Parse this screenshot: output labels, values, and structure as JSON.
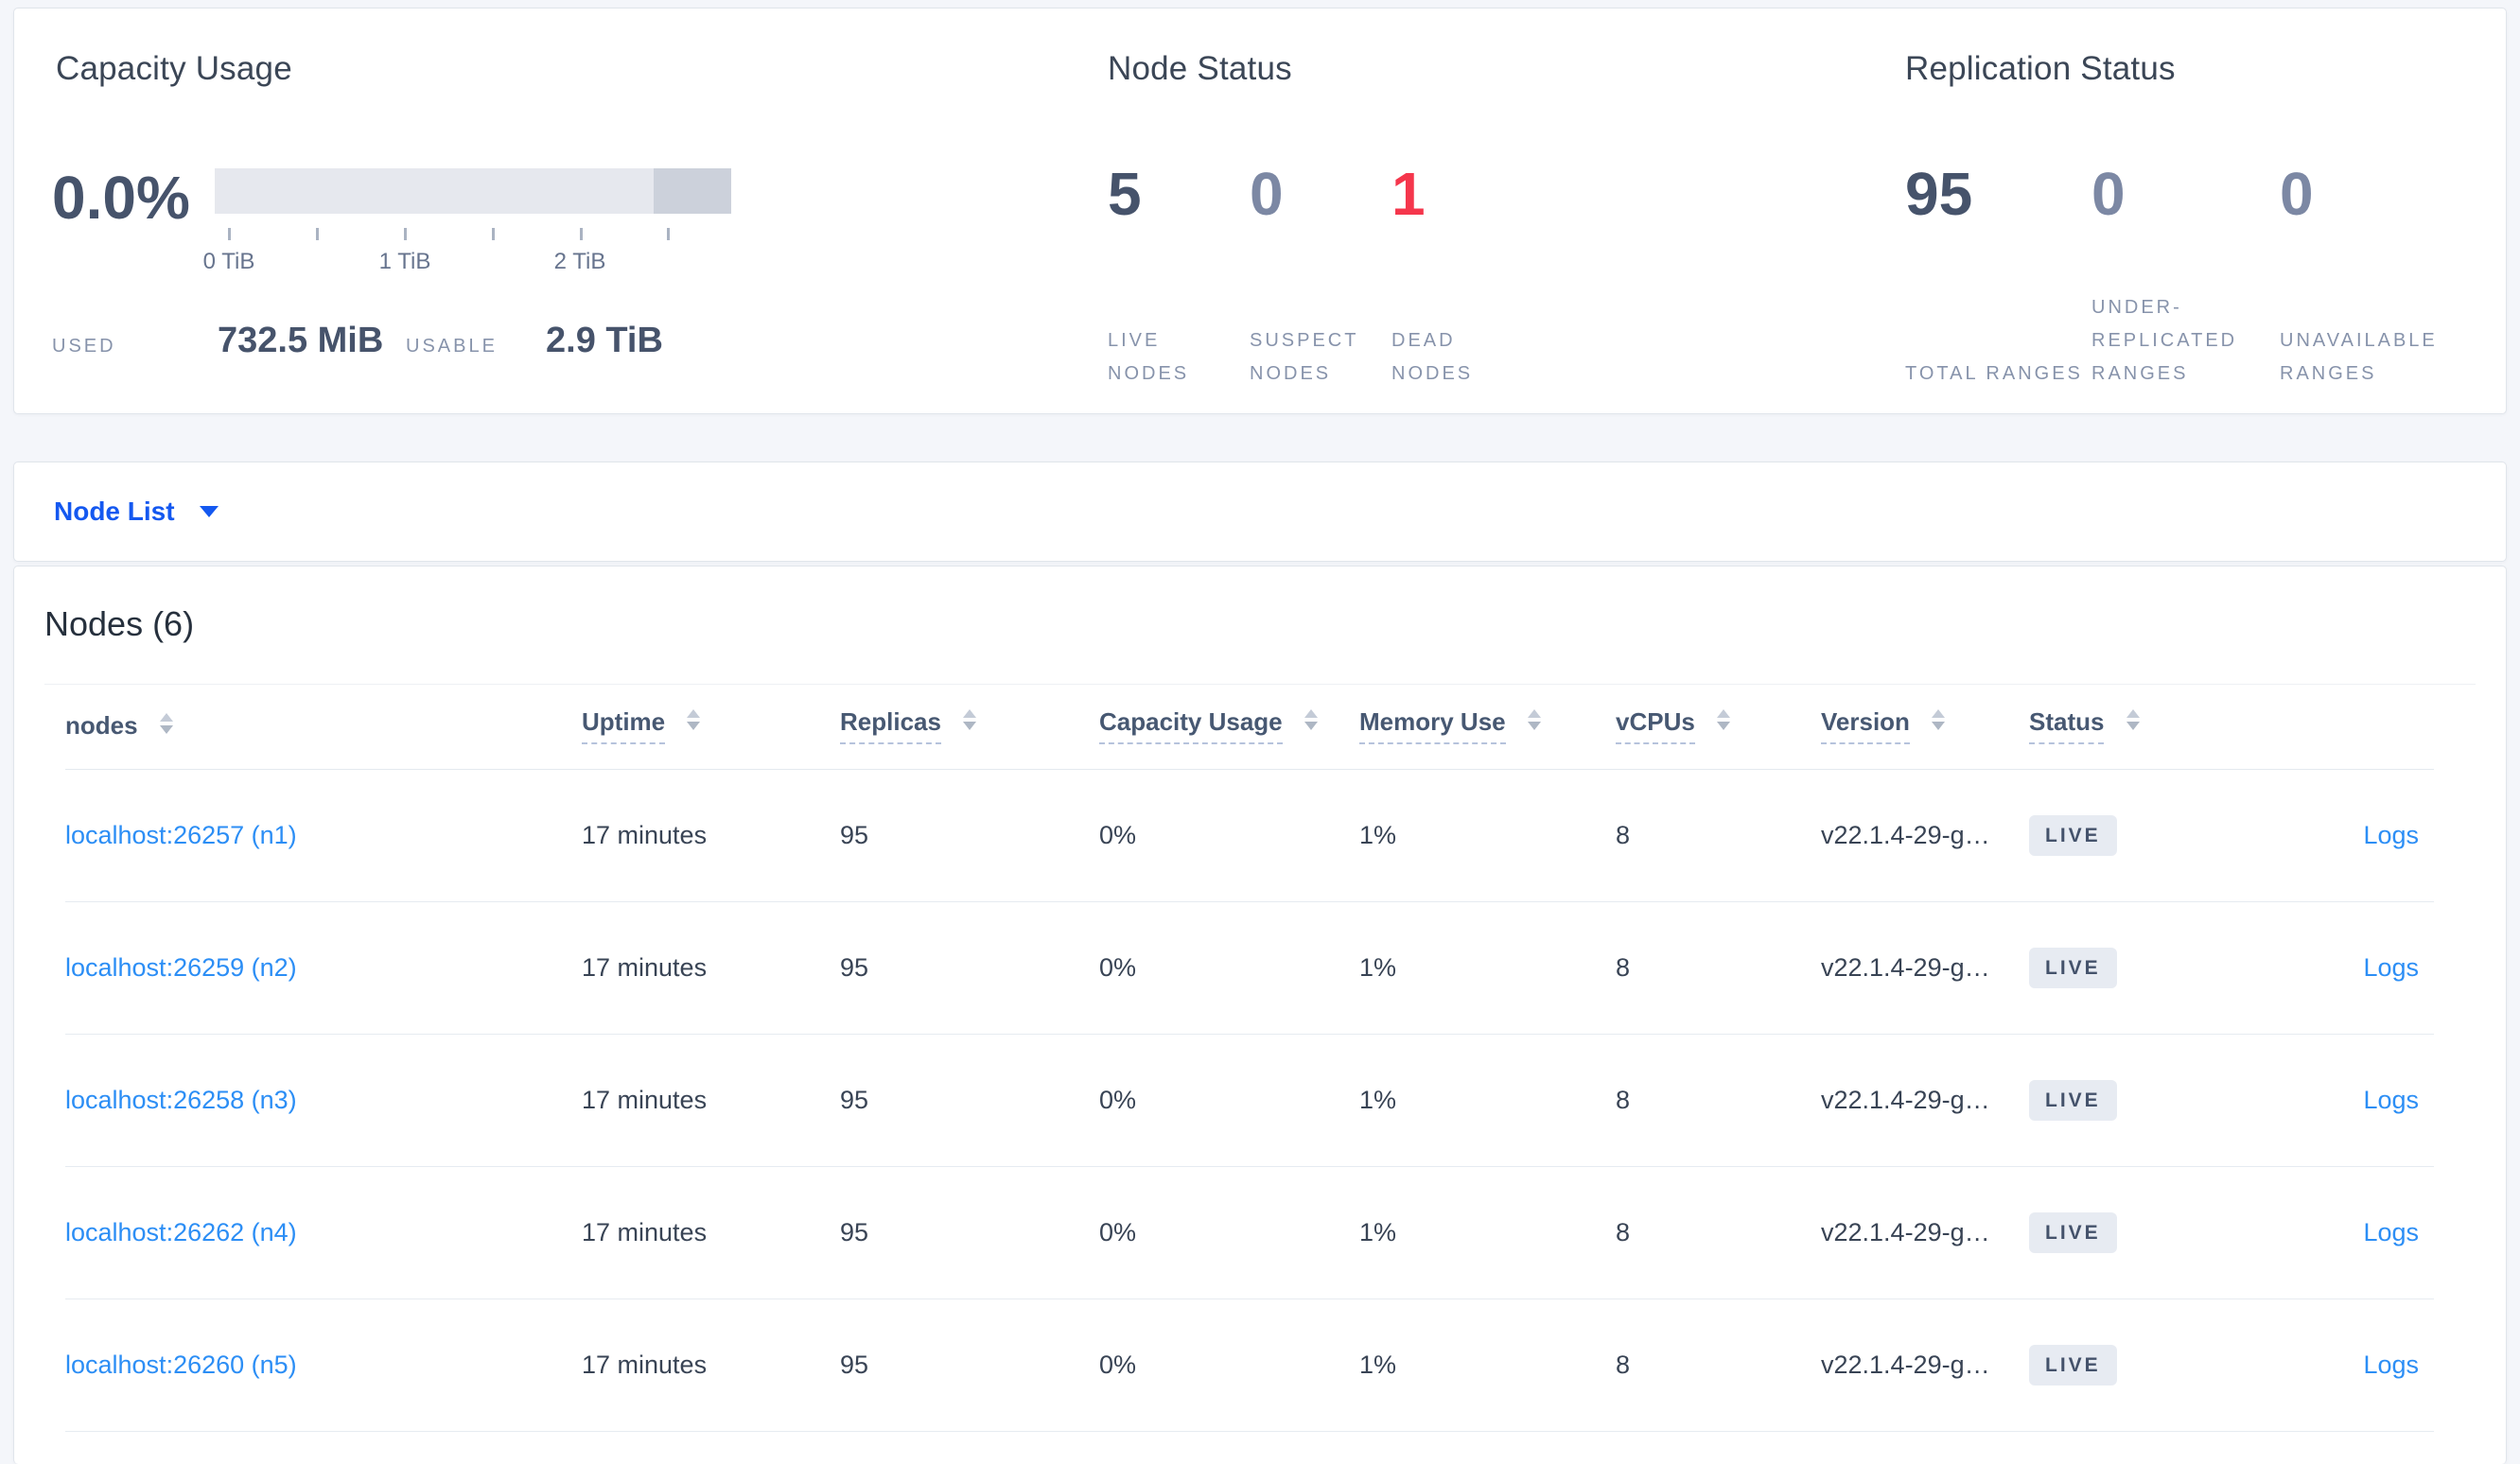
{
  "summary": {
    "capacity_usage": {
      "title": "Capacity Usage",
      "percent_used": "0.0%",
      "axis_ticks": [
        "0 TiB",
        "1 TiB",
        "2 TiB"
      ],
      "used_label": "USED",
      "used_value": "732.5 MiB",
      "usable_label": "USABLE",
      "usable_value": "2.9 TiB"
    },
    "node_status": {
      "title": "Node Status",
      "metrics": [
        {
          "value": "5",
          "label": "LIVE NODES",
          "tone": "dark"
        },
        {
          "value": "0",
          "label": "SUSPECT NODES",
          "tone": "muted"
        },
        {
          "value": "1",
          "label": "DEAD NODES",
          "tone": "danger"
        }
      ]
    },
    "replication_status": {
      "title": "Replication Status",
      "metrics": [
        {
          "value": "95",
          "label": "TOTAL RANGES",
          "tone": "dark"
        },
        {
          "value": "0",
          "label": "UNDER-REPLICATED RANGES",
          "tone": "muted"
        },
        {
          "value": "0",
          "label": "UNAVAILABLE RANGES",
          "tone": "muted"
        }
      ]
    }
  },
  "view_selector": {
    "label": "Node List",
    "icon": "chevron-down-icon"
  },
  "nodes_section": {
    "heading": "Nodes (6)",
    "columns": [
      {
        "label": "nodes"
      },
      {
        "label": "Uptime"
      },
      {
        "label": "Replicas"
      },
      {
        "label": "Capacity Usage"
      },
      {
        "label": "Memory Use"
      },
      {
        "label": "vCPUs"
      },
      {
        "label": "Version"
      },
      {
        "label": "Status"
      },
      {
        "label": ""
      }
    ],
    "rows": [
      {
        "node": "localhost:26257 (n1)",
        "uptime": "17 minutes",
        "replicas": "95",
        "capacity": "0%",
        "memory": "1%",
        "vcpus": "8",
        "version": "v22.1.4-29-g…",
        "status": "LIVE",
        "logs": "Logs"
      },
      {
        "node": "localhost:26259 (n2)",
        "uptime": "17 minutes",
        "replicas": "95",
        "capacity": "0%",
        "memory": "1%",
        "vcpus": "8",
        "version": "v22.1.4-29-g…",
        "status": "LIVE",
        "logs": "Logs"
      },
      {
        "node": "localhost:26258 (n3)",
        "uptime": "17 minutes",
        "replicas": "95",
        "capacity": "0%",
        "memory": "1%",
        "vcpus": "8",
        "version": "v22.1.4-29-g…",
        "status": "LIVE",
        "logs": "Logs"
      },
      {
        "node": "localhost:26262 (n4)",
        "uptime": "17 minutes",
        "replicas": "95",
        "capacity": "0%",
        "memory": "1%",
        "vcpus": "8",
        "version": "v22.1.4-29-g…",
        "status": "LIVE",
        "logs": "Logs"
      },
      {
        "node": "localhost:26260 (n5)",
        "uptime": "17 minutes",
        "replicas": "95",
        "capacity": "0%",
        "memory": "1%",
        "vcpus": "8",
        "version": "v22.1.4-29-g…",
        "status": "LIVE",
        "logs": "Logs"
      }
    ]
  },
  "colors": {
    "page-bg": "#f4f6fa",
    "accent-blue": "#1458f0",
    "link-blue": "#2c8ef5",
    "danger-red": "#f5364c",
    "num-dark": "#46536b",
    "num-muted": "#7c88a4",
    "text-dark": "#394455",
    "label-muted": "#8793ab",
    "badge-bg": "#e7ebf2",
    "bar-light": "#e6e8ee",
    "bar-dark": "#ccd1db"
  }
}
